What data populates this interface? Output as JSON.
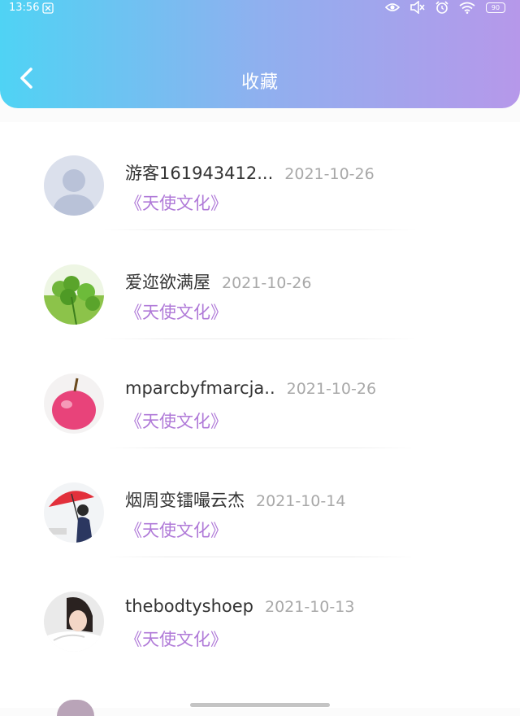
{
  "status_bar": {
    "time": "13:56",
    "battery": "90"
  },
  "header": {
    "title": "收藏"
  },
  "favorites": [
    {
      "name": "游客161943412...",
      "date": "2021-10-26",
      "tag": "《天使文化》",
      "avatar": "default-person-avatar"
    },
    {
      "name": "爱迩欲满屋",
      "date": "2021-10-26",
      "tag": "《天使文化》",
      "avatar": "clover-avatar"
    },
    {
      "name": "mparcbyfmarcja..",
      "date": "2021-10-26",
      "tag": "《天使文化》",
      "avatar": "apple-avatar"
    },
    {
      "name": "烟周变镭嘬云杰",
      "date": "2021-10-14",
      "tag": "《天使文化》",
      "avatar": "umbrella-girl-avatar"
    },
    {
      "name": "thebodtyshoep",
      "date": "2021-10-13",
      "tag": "《天使文化》",
      "avatar": "resting-girl-avatar"
    }
  ],
  "colors": {
    "header_start": "#4fd3f4",
    "header_end": "#b698ea",
    "tag": "#b07ad8",
    "date": "#a8a8a8"
  }
}
